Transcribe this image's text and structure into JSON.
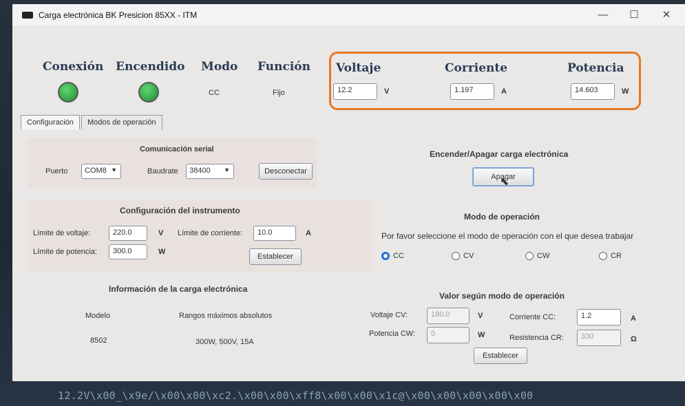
{
  "window": {
    "title": "Carga electrónica BK Presicion 85XX - ITM",
    "minimize": "—",
    "maximize": "☐",
    "close": "✕"
  },
  "status": {
    "conexion_label": "Conexión",
    "encendido_label": "Encendido",
    "modo_label": "Modo",
    "modo_value": "CC",
    "funcion_label": "Función",
    "funcion_value": "Fijo",
    "led_color": "#3aa84a"
  },
  "readings": {
    "voltaje_label": "Voltaje",
    "voltaje_value": "12.2",
    "voltaje_unit": "V",
    "corriente_label": "Corriente",
    "corriente_value": "1.197",
    "corriente_unit": "A",
    "potencia_label": "Potencia",
    "potencia_value": "14.603",
    "potencia_unit": "W",
    "highlight_color": "#e87722"
  },
  "tabs": [
    "Configuración",
    "Modos de operación"
  ],
  "serial": {
    "title": "Comunicación serial",
    "puerto_label": "Puerto",
    "puerto_value": "COM8",
    "baudrate_label": "Baudrate",
    "baudrate_value": "38400",
    "disconnect_button": "Desconectar"
  },
  "power": {
    "title": "Encender/Apagar carga electrónica",
    "button": "Apagar"
  },
  "instrument": {
    "title": "Configuración del instrumento",
    "voltage_limit_label": "Límite de voltaje:",
    "voltage_limit_value": "220.0",
    "voltage_unit": "V",
    "current_limit_label": "Límite de corriente:",
    "current_limit_value": "10.0",
    "current_unit": "A",
    "power_limit_label": "Límite de potencia:",
    "power_limit_value": "300.0",
    "power_unit": "W",
    "set_button": "Establecer"
  },
  "mode": {
    "title": "Modo de operación",
    "prompt": "Por favor seleccione el modo de operación con el que desea trabajar",
    "options": [
      "CC",
      "CV",
      "CW",
      "CR"
    ],
    "selected": "CC"
  },
  "info": {
    "title": "Información de la carga electrónica",
    "model_label": "Modelo",
    "model_value": "8502",
    "ranges_label": "Rangos máximos absolutos",
    "ranges_value": "300W, 500V, 15A"
  },
  "values": {
    "title": "Valor según modo de operación",
    "cv_label": "Voltaje CV:",
    "cv_value": "180.0",
    "cv_unit": "V",
    "cc_label": "Corriente CC:",
    "cc_value": "1.2",
    "cc_unit": "A",
    "cw_label": "Potencia CW:",
    "cw_value": "0",
    "cw_unit": "W",
    "cr_label": "Resistencia CR:",
    "cr_value": "330",
    "cr_unit": "Ω",
    "set_button": "Establecer"
  },
  "terminal": {
    "text": "12.2V\\x00_\\x9e/\\x00\\x00\\xc2.\\x00\\x00\\xff8\\x00\\x00\\x1c@\\x00\\x00\\x00\\x00\\x00"
  }
}
